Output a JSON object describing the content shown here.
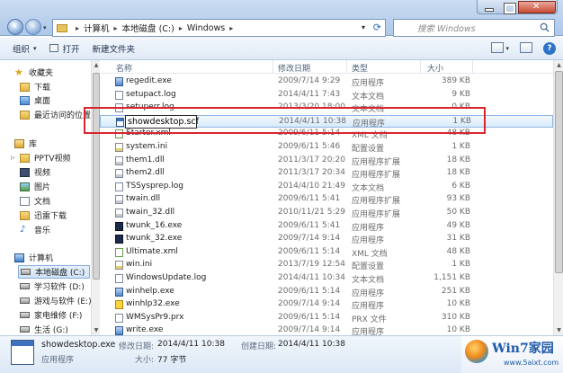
{
  "address": {
    "crumbs": [
      "计算机",
      "本地磁盘 (C:)",
      "Windows"
    ],
    "search_placeholder": "搜索 Windows"
  },
  "toolbar": {
    "organize": "组织",
    "open": "打开",
    "new_folder": "新建文件夹"
  },
  "nav": {
    "favorites": "收藏夹",
    "downloads": "下载",
    "desktop": "桌面",
    "recent": "最近访问的位置",
    "libraries": "库",
    "pptv": "PPTV视频",
    "videos": "视频",
    "pictures": "图片",
    "documents": "文档",
    "thunder": "迅雷下载",
    "music": "音乐",
    "computer": "计算机",
    "drive_c": "本地磁盘 (C:)",
    "drive_d": "学习软件 (D:)",
    "drive_e": "游戏与软件 (E:)",
    "drive_f": "家电维修 (F:)",
    "drive_g": "生活 (G:)"
  },
  "columns": {
    "name": "名称",
    "date": "修改日期",
    "type": "类型",
    "size": "大小"
  },
  "files": [
    {
      "name": "regedit.exe",
      "date": "2009/7/14 9:29",
      "type": "应用程序",
      "size": "389 KB",
      "icon": "exe"
    },
    {
      "name": "setupact.log",
      "date": "2014/4/11 7:43",
      "type": "文本文档",
      "size": "9 KB",
      "icon": "log"
    },
    {
      "name": "setuperr.log",
      "date": "2013/3/20 18:00",
      "type": "文本文档",
      "size": "0 KB",
      "icon": "log"
    },
    {
      "name": "showdesktop.scf",
      "date": "2014/4/11 10:38",
      "type": "应用程序",
      "size": "1 KB",
      "icon": "scf"
    },
    {
      "name": "Starter.xml",
      "date": "2009/6/11 5:14",
      "type": "XML 文档",
      "size": "48 KB",
      "icon": "xml"
    },
    {
      "name": "system.ini",
      "date": "2009/6/11 5:46",
      "type": "配置设置",
      "size": "1 KB",
      "icon": "ini"
    },
    {
      "name": "them1.dll",
      "date": "2011/3/17 20:20",
      "type": "应用程序扩展",
      "size": "18 KB",
      "icon": "dll"
    },
    {
      "name": "them2.dll",
      "date": "2011/3/17 20:34",
      "type": "应用程序扩展",
      "size": "18 KB",
      "icon": "dll"
    },
    {
      "name": "TSSysprep.log",
      "date": "2014/4/10 21:49",
      "type": "文本文档",
      "size": "6 KB",
      "icon": "log"
    },
    {
      "name": "twain.dll",
      "date": "2009/6/11 5:41",
      "type": "应用程序扩展",
      "size": "93 KB",
      "icon": "dll"
    },
    {
      "name": "twain_32.dll",
      "date": "2010/11/21 5:29",
      "type": "应用程序扩展",
      "size": "50 KB",
      "icon": "dll"
    },
    {
      "name": "twunk_16.exe",
      "date": "2009/6/11 5:41",
      "type": "应用程序",
      "size": "49 KB",
      "icon": "twunk"
    },
    {
      "name": "twunk_32.exe",
      "date": "2009/7/14 9:14",
      "type": "应用程序",
      "size": "31 KB",
      "icon": "twunk"
    },
    {
      "name": "Ultimate.xml",
      "date": "2009/6/11 5:14",
      "type": "XML 文档",
      "size": "48 KB",
      "icon": "xml"
    },
    {
      "name": "win.ini",
      "date": "2013/7/19 12:54",
      "type": "配置设置",
      "size": "1 KB",
      "icon": "ini"
    },
    {
      "name": "WindowsUpdate.log",
      "date": "2014/4/11 10:34",
      "type": "文本文档",
      "size": "1,151 KB",
      "icon": "log"
    },
    {
      "name": "winhelp.exe",
      "date": "2009/6/11 5:14",
      "type": "应用程序",
      "size": "251 KB",
      "icon": "exe"
    },
    {
      "name": "winhlp32.exe",
      "date": "2009/7/14 9:14",
      "type": "应用程序",
      "size": "10 KB",
      "icon": "help"
    },
    {
      "name": "WMSysPr9.prx",
      "date": "2009/6/11 5:14",
      "type": "PRX 文件",
      "size": "310 KB",
      "icon": "log"
    },
    {
      "name": "write.exe",
      "date": "2009/7/14 9:14",
      "type": "应用程序",
      "size": "10 KB",
      "icon": "exe"
    }
  ],
  "rename_value": "showdesktop.scf",
  "details": {
    "name": "showdesktop.exe",
    "type": "应用程序",
    "modified_label": "修改日期:",
    "modified_value": "2014/4/11 10:38",
    "size_label": "大小:",
    "size_value": "77 字节",
    "created_label": "创建日期:",
    "created_value": "2014/4/11 10:38"
  },
  "watermark": {
    "title": "Win7家园",
    "url": "www.5aixt.com"
  },
  "colors": {
    "highlight_rect": "#d7262e",
    "selection": "#d8eafb",
    "accent": "#1f5aa8"
  }
}
